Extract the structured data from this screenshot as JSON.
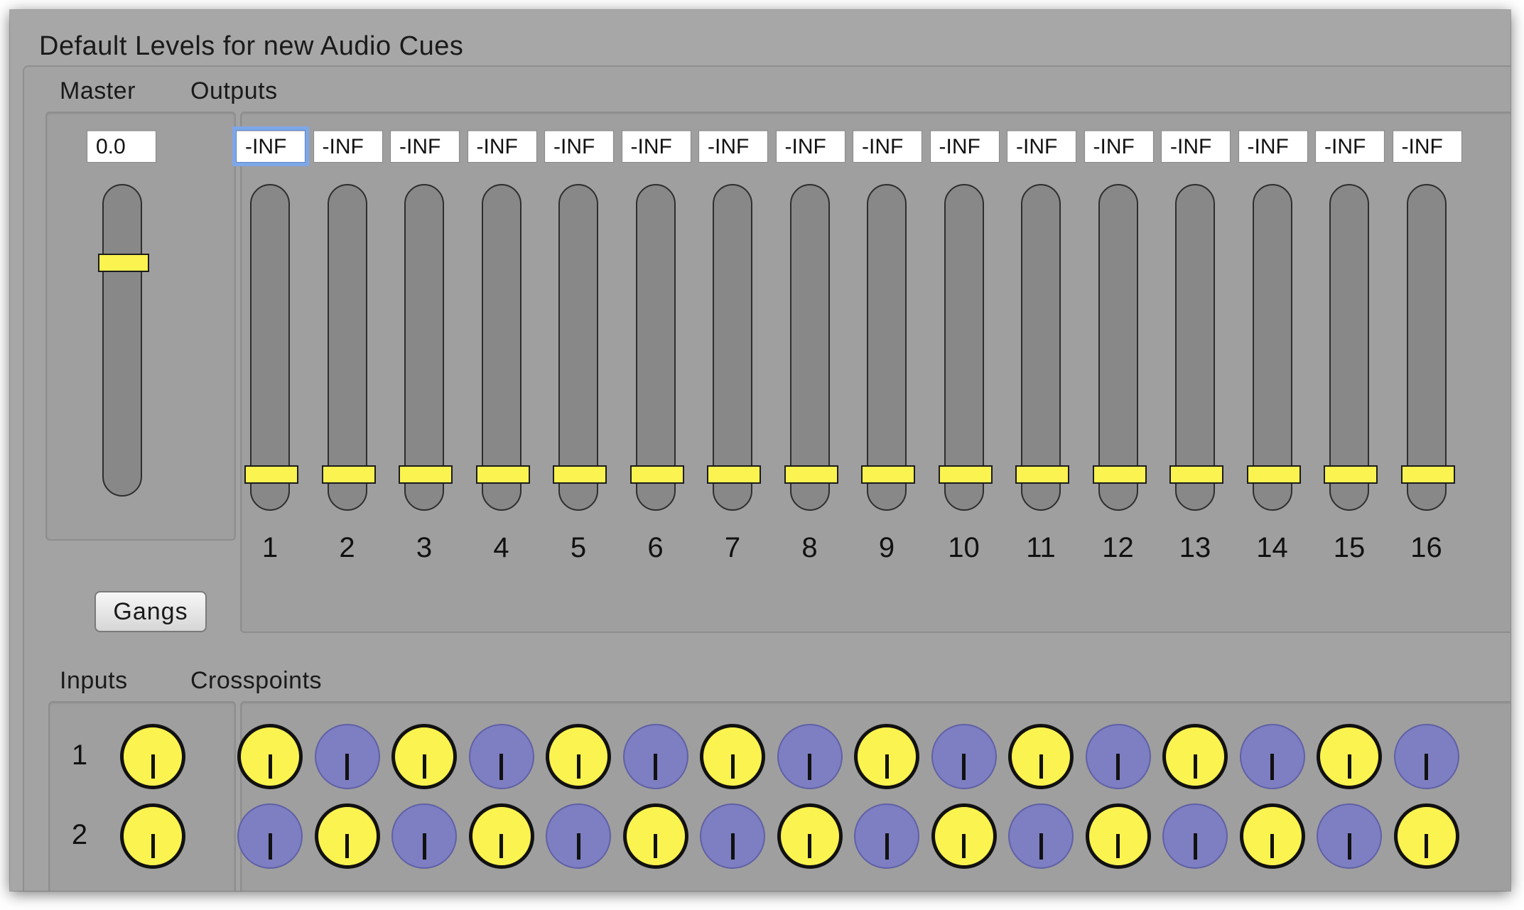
{
  "section_title": "Default Levels for new Audio Cues",
  "master": {
    "label": "Master",
    "value": "0.0",
    "level_fraction": 0.78
  },
  "gangs_label": "Gangs",
  "outputs": {
    "label": "Outputs",
    "channels": [
      {
        "number": "1",
        "value": "-INF",
        "focused": true
      },
      {
        "number": "2",
        "value": "-INF"
      },
      {
        "number": "3",
        "value": "-INF"
      },
      {
        "number": "4",
        "value": "-INF"
      },
      {
        "number": "5",
        "value": "-INF"
      },
      {
        "number": "6",
        "value": "-INF"
      },
      {
        "number": "7",
        "value": "-INF"
      },
      {
        "number": "8",
        "value": "-INF"
      },
      {
        "number": "9",
        "value": "-INF"
      },
      {
        "number": "10",
        "value": "-INF"
      },
      {
        "number": "11",
        "value": "-INF"
      },
      {
        "number": "12",
        "value": "-INF"
      },
      {
        "number": "13",
        "value": "-INF"
      },
      {
        "number": "14",
        "value": "-INF"
      },
      {
        "number": "15",
        "value": "-INF"
      },
      {
        "number": "16",
        "value": "-INF"
      }
    ]
  },
  "inputs": {
    "label": "Inputs",
    "rows": [
      {
        "number": "1"
      },
      {
        "number": "2"
      }
    ]
  },
  "crosspoints": {
    "label": "Crosspoints",
    "rows": [
      [
        true,
        false,
        true,
        false,
        true,
        false,
        true,
        false,
        true,
        false,
        true,
        false,
        true,
        false,
        true,
        false
      ],
      [
        false,
        true,
        false,
        true,
        false,
        true,
        false,
        true,
        false,
        true,
        false,
        true,
        false,
        true,
        false,
        true
      ]
    ]
  },
  "colors": {
    "thumb": "#fbf34f",
    "knob_on": "#fbf34f",
    "knob_off": "#7e7ec2",
    "focus_ring": "#7ea7e8"
  }
}
